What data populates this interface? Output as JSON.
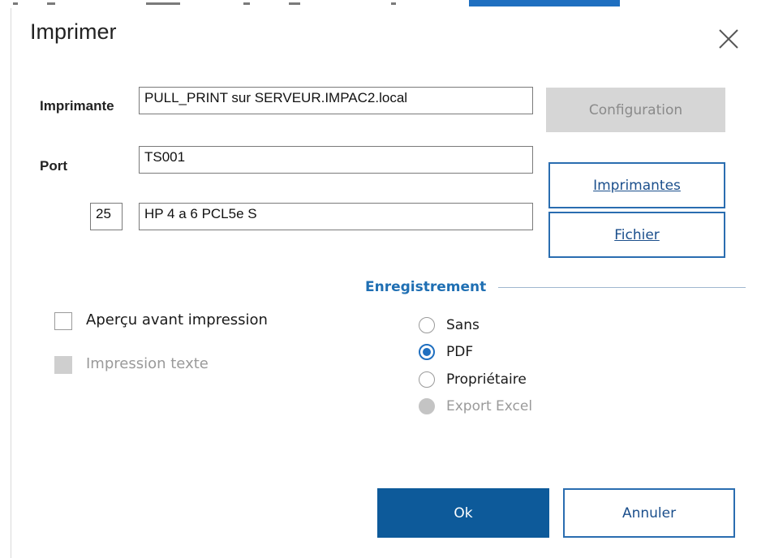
{
  "dialog": {
    "title": "Imprimer"
  },
  "printer": {
    "label": "Imprimante",
    "value": "PULL_PRINT sur SERVEUR.IMPAC2.local"
  },
  "port": {
    "label": "Port",
    "value": "TS001"
  },
  "model": {
    "number": "25",
    "name": "HP 4 a 6   PCL5e   S"
  },
  "buttons": {
    "configuration": "Configuration",
    "printers": "Imprimantes",
    "file": "Fichier",
    "ok": "Ok",
    "cancel": "Annuler"
  },
  "options": {
    "preview_label": "Aperçu avant impression",
    "preview_checked": false,
    "text_print_label": "Impression texte",
    "text_print_enabled": false
  },
  "recording": {
    "title": "Enregistrement",
    "items": [
      {
        "label": "Sans",
        "checked": false,
        "enabled": true
      },
      {
        "label": "PDF",
        "checked": true,
        "enabled": true
      },
      {
        "label": "Propriétaire",
        "checked": false,
        "enabled": true
      },
      {
        "label": "Export Excel",
        "checked": false,
        "enabled": false
      }
    ]
  },
  "colors": {
    "accent": "#1f6fc0",
    "primary_button": "#0d5a9a",
    "disabled": "#d6d6d6"
  }
}
